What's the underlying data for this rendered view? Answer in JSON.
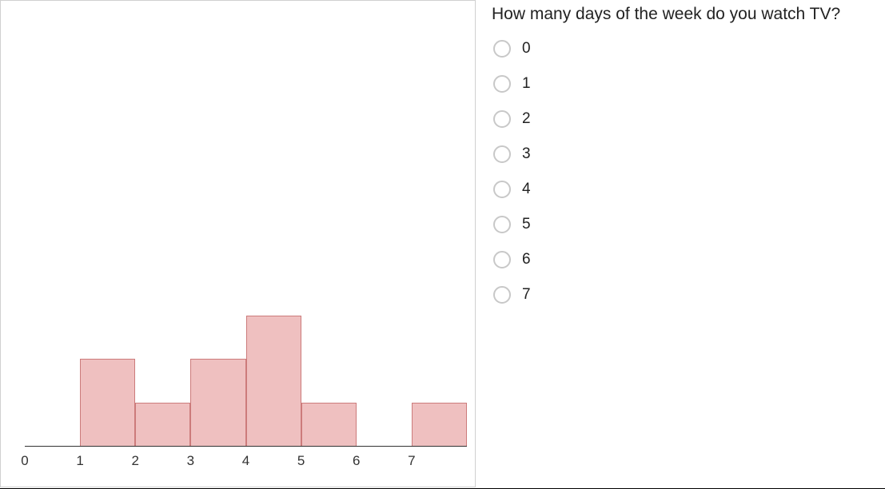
{
  "chart_data": {
    "type": "bar",
    "categories": [
      "0",
      "1",
      "2",
      "3",
      "4",
      "5",
      "6",
      "7"
    ],
    "values": [
      0,
      2,
      1,
      2,
      3,
      1,
      0,
      1
    ],
    "ylim": [
      0,
      10
    ],
    "xlabel": "",
    "ylabel": "",
    "title": "",
    "bar_fill": "#efc0c0",
    "bar_stroke": "#cc7b7b"
  },
  "question": {
    "prompt": "How many days of the week do you watch TV?",
    "options": [
      "0",
      "1",
      "2",
      "3",
      "4",
      "5",
      "6",
      "7"
    ]
  }
}
